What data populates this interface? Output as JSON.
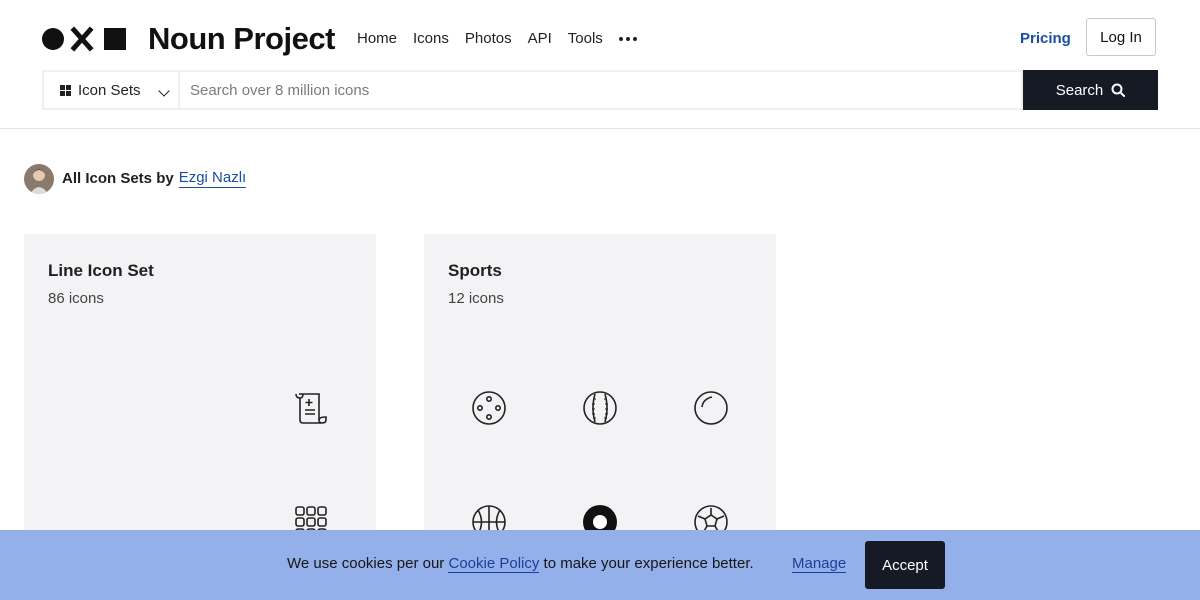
{
  "header": {
    "logo_text": "Noun Project",
    "nav": [
      "Home",
      "Icons",
      "Photos",
      "API",
      "Tools"
    ],
    "more_icon": "ellipsis-icon",
    "pricing_label": "Pricing",
    "login_label": "Log In"
  },
  "search": {
    "scope_label": "Icon Sets",
    "placeholder": "Search over 8 million icons",
    "button_label": "Search"
  },
  "author": {
    "prefix": "All Icon Sets by",
    "name": "Ezgi Nazlı"
  },
  "cards": [
    {
      "title": "Line Icon Set",
      "count": "86 icons",
      "icons": [
        "scroll-document-icon",
        "grid-dots-icon"
      ]
    },
    {
      "title": "Sports",
      "count": "12 icons",
      "icons": [
        "dotted-ball-icon",
        "baseball-icon",
        "bowling-ball-icon",
        "basketball-icon",
        "pool-ball-icon",
        "soccer-ball-icon"
      ]
    }
  ],
  "cookie": {
    "text_before": "We use cookies per our",
    "link": "Cookie Policy",
    "text_after": "to make your experience better.",
    "manage_label": "Manage",
    "accept_label": "Accept"
  },
  "colors": {
    "link_blue": "#1a4fa0",
    "dark_button": "#161a25",
    "card_bg": "#f3f3f5",
    "cookie_bg": "#94b0ea"
  }
}
